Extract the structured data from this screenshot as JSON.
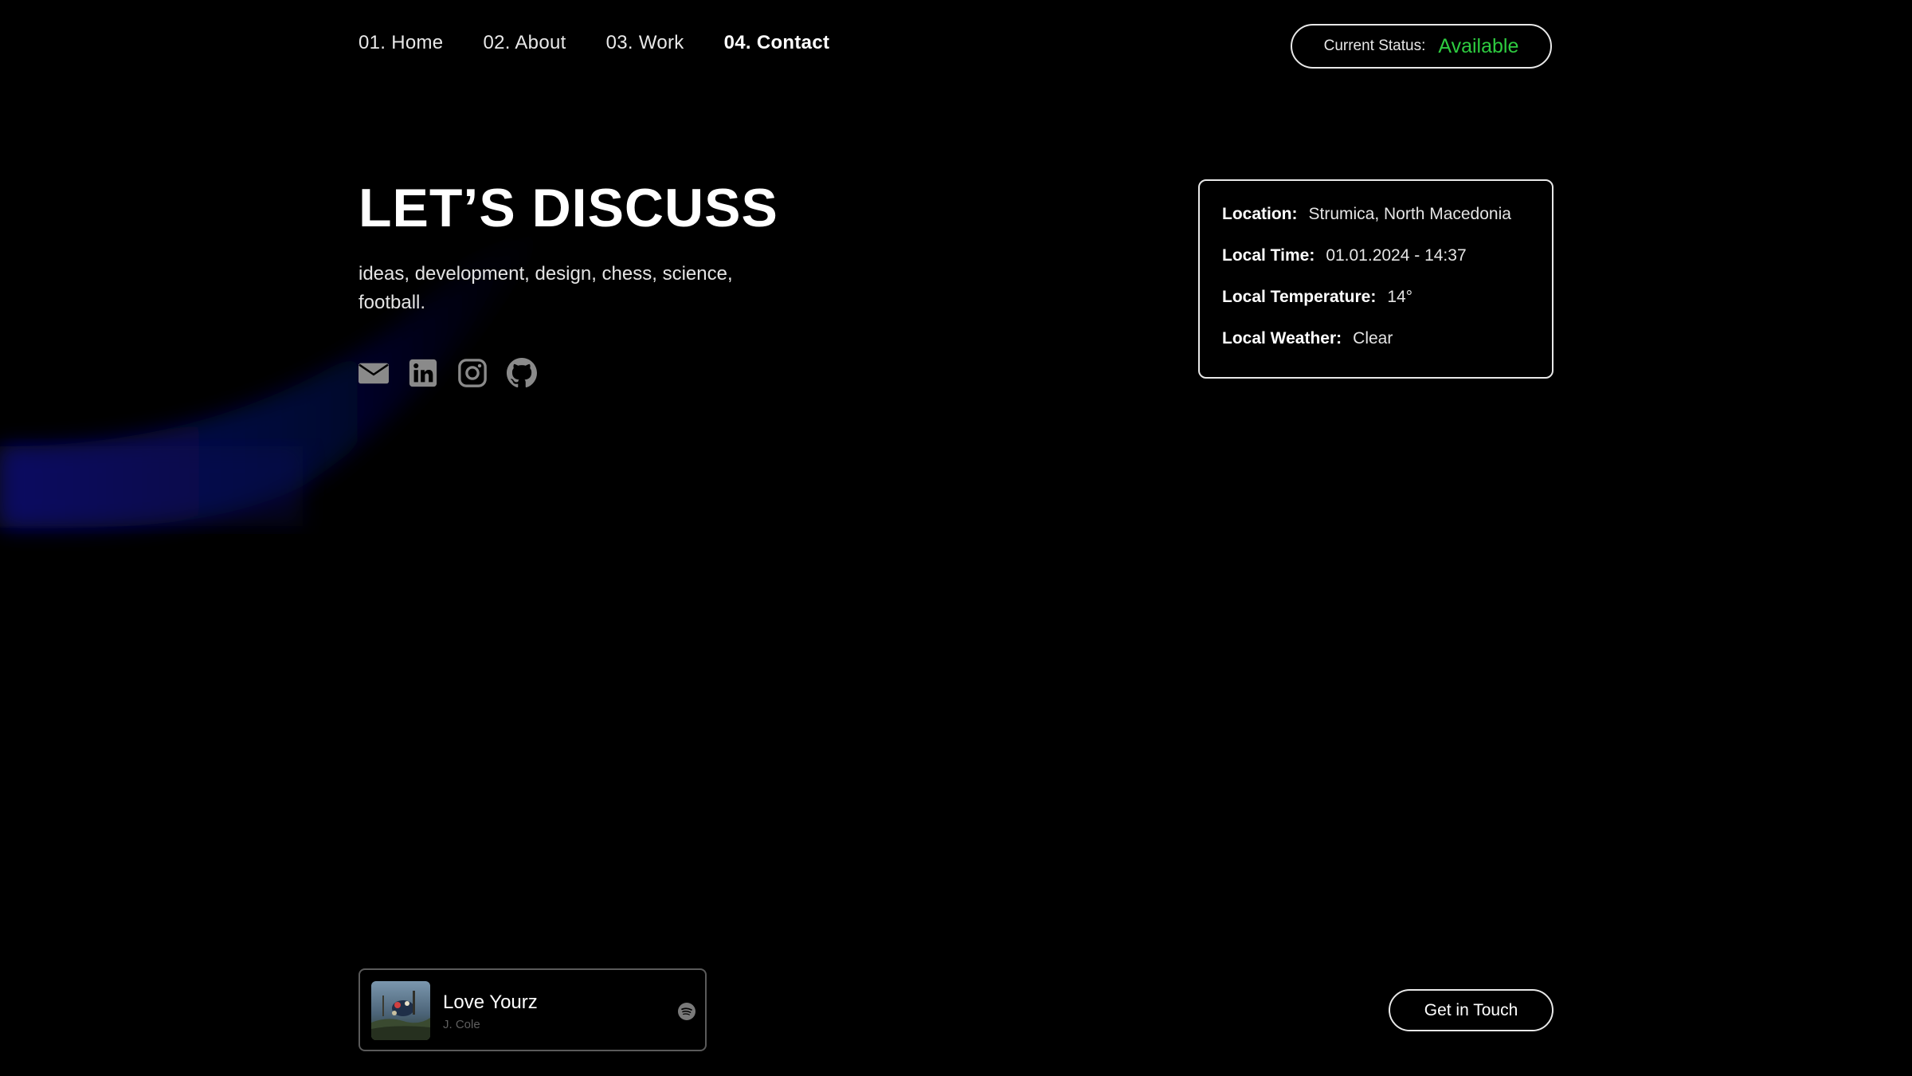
{
  "nav": {
    "items": [
      {
        "label": "01. Home"
      },
      {
        "label": "02. About"
      },
      {
        "label": "03. Work"
      },
      {
        "label": "04. Contact"
      }
    ],
    "active_index": 3
  },
  "status": {
    "label": "Current Status:",
    "value": "Available",
    "value_color": "#2ecc40"
  },
  "hero": {
    "title": "LET’S DISCUSS",
    "subtitle": "ideas, development, design, chess, science, football."
  },
  "socials": [
    {
      "icon": "mail-icon"
    },
    {
      "icon": "linkedin-icon"
    },
    {
      "icon": "instagram-icon"
    },
    {
      "icon": "github-icon"
    }
  ],
  "info": {
    "rows": [
      {
        "key": "Location:",
        "value": "Strumica, North Macedonia"
      },
      {
        "key": "Local Time:",
        "value": "01.01.2024 - 14:37"
      },
      {
        "key": "Local Temperature:",
        "value": "14°"
      },
      {
        "key": "Local Weather:",
        "value": "Clear"
      }
    ]
  },
  "now_playing": {
    "title": "Love Yourz",
    "artist": "J. Cole",
    "service_icon": "spotify-icon"
  },
  "cta": {
    "label": "Get in Touch"
  },
  "colors": {
    "background": "#000000",
    "accent_glow": "#0a1180",
    "icon_gray": "#8a8a8a"
  }
}
